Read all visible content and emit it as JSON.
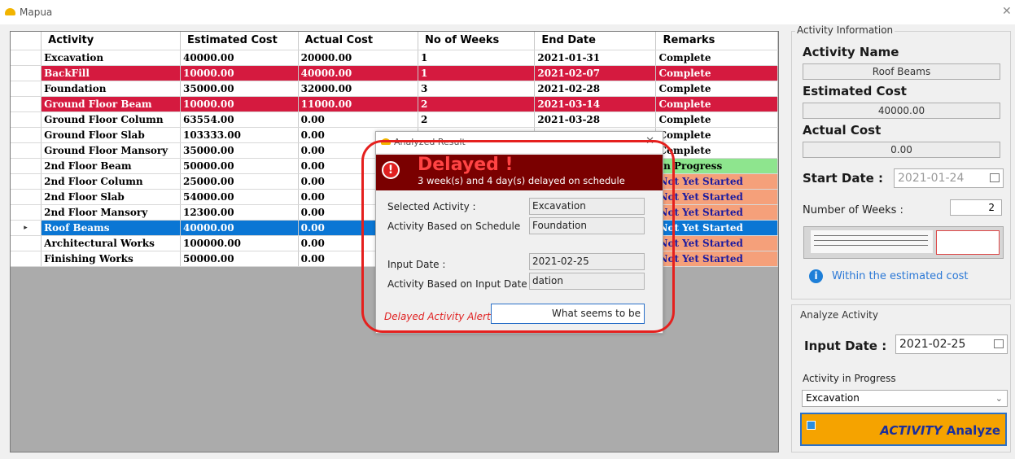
{
  "window": {
    "title": "Mapua",
    "close_glyph": "✕"
  },
  "grid": {
    "columns": [
      "Activity",
      "Estimated Cost",
      "Actual Cost",
      "No of Weeks",
      "End Date",
      "Remarks"
    ],
    "rows": [
      {
        "activity": "Excavation",
        "est": "40000.00",
        "act": "20000.00",
        "weeks": "1",
        "end": "2021-01-31",
        "remarks": "Complete",
        "style": "plain"
      },
      {
        "activity": "BackFill",
        "est": "10000.00",
        "act": "40000.00",
        "weeks": "1",
        "end": "2021-02-07",
        "remarks": "Complete",
        "style": "red"
      },
      {
        "activity": "Foundation",
        "est": "35000.00",
        "act": "32000.00",
        "weeks": "3",
        "end": "2021-02-28",
        "remarks": "Complete",
        "style": "plain"
      },
      {
        "activity": "Ground Floor Beam",
        "est": "10000.00",
        "act": "11000.00",
        "weeks": "2",
        "end": "2021-03-14",
        "remarks": "Complete",
        "style": "red"
      },
      {
        "activity": "Ground Floor Column",
        "est": "63554.00",
        "act": "0.00",
        "weeks": "2",
        "end": "2021-03-28",
        "remarks": "Complete",
        "style": "plain"
      },
      {
        "activity": "Ground Floor Slab",
        "est": "103333.00",
        "act": "0.00",
        "weeks": "",
        "end": "",
        "remarks": "Complete",
        "style": "plain"
      },
      {
        "activity": "Ground Floor Mansory",
        "est": "35000.00",
        "act": "0.00",
        "weeks": "",
        "end": "",
        "remarks": "Complete",
        "style": "plain"
      },
      {
        "activity": "2nd Floor Beam",
        "est": "50000.00",
        "act": "0.00",
        "weeks": "",
        "end": "",
        "remarks": "In Progress",
        "style": "green"
      },
      {
        "activity": "2nd Floor Column",
        "est": "25000.00",
        "act": "0.00",
        "weeks": "",
        "end": "",
        "remarks": "Not Yet Started",
        "style": "orange"
      },
      {
        "activity": "2nd Floor Slab",
        "est": "54000.00",
        "act": "0.00",
        "weeks": "",
        "end": "",
        "remarks": "Not Yet Started",
        "style": "orange"
      },
      {
        "activity": "2nd Floor Mansory",
        "est": "12300.00",
        "act": "0.00",
        "weeks": "",
        "end": "",
        "remarks": "Not Yet Started",
        "style": "orange"
      },
      {
        "activity": "Roof Beams",
        "est": "40000.00",
        "act": "0.00",
        "weeks": "",
        "end": "",
        "remarks": "Not Yet Started",
        "style": "selected"
      },
      {
        "activity": "Architectural Works",
        "est": "100000.00",
        "act": "0.00",
        "weeks": "",
        "end": "",
        "remarks": "Not Yet Started",
        "style": "orange"
      },
      {
        "activity": "Finishing Works",
        "est": "50000.00",
        "act": "0.00",
        "weeks": "",
        "end": "",
        "remarks": "Not Yet Started",
        "style": "orange"
      }
    ],
    "selected_row_marker": "▸"
  },
  "info": {
    "legend": "Activity Information",
    "activity_name_label": "Activity Name",
    "activity_name_value": "Roof Beams",
    "estimated_cost_label": "Estimated Cost",
    "estimated_cost_value": "40000.00",
    "actual_cost_label": "Actual Cost",
    "actual_cost_value": "0.00",
    "start_date_label": "Start Date :",
    "start_date_value": "2021-01-24",
    "weeks_label": "Number of Weeks :",
    "weeks_value": "2",
    "status_text": "Within the estimated cost"
  },
  "analyze": {
    "legend": "Analyze Activity",
    "input_date_label": "Input Date :",
    "input_date_value": "2021-02-25",
    "in_progress_label": "Activity in Progress",
    "in_progress_value": "Excavation",
    "button_italic": "ACTIVITY",
    "button_text": "Analyze"
  },
  "dialog": {
    "title": "Analyzed Result",
    "close_glyph": "✕",
    "banner_title": "Delayed !",
    "banner_subtitle": "3 week(s) and 4 day(s) delayed on schedule",
    "selected_activity_label": "Selected Activity :",
    "selected_activity_value": "Excavation",
    "based_schedule_label": "Activity Based on Schedule",
    "based_schedule_value": "Foundation",
    "input_date_label": "Input Date :",
    "input_date_value": "2021-02-25",
    "based_input_label": "Activity Based on Input Date :",
    "based_input_value": "dation",
    "alert_label": "Delayed Activity Alert *",
    "alert_button": "What seems to be"
  },
  "colors": {
    "delayed_row": "#d51a3f",
    "selected_row": "#0a76d4",
    "in_progress": "#8ee58e",
    "not_started": "#f5a07a",
    "analyze_button": "#f5a300",
    "banner": "#7a0000"
  },
  "icons": [
    "app-icon",
    "close-icon",
    "calendar-icon",
    "info-icon",
    "warning-icon",
    "search-icon"
  ]
}
